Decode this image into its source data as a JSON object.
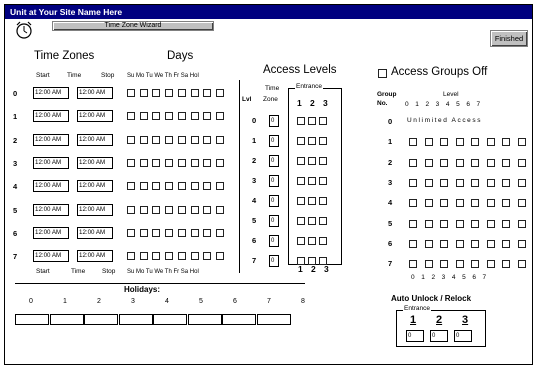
{
  "window": {
    "title": "Unit at Your Site Name Here"
  },
  "toolbar": {
    "wizard_label": "Time Zone Wizard",
    "finished_label": "Finished"
  },
  "timezones": {
    "title": "Time Zones",
    "days_title": "Days",
    "head_start": "Start",
    "head_time": "Time",
    "head_stop": "Stop",
    "days_header": "Su Mo Tu We Th Fr Sa Hol",
    "rows": [
      {
        "num": "0",
        "start": "12:00 AM",
        "stop": "12:00 AM"
      },
      {
        "num": "1",
        "start": "12:00 AM",
        "stop": "12:00 AM"
      },
      {
        "num": "2",
        "start": "12:00 AM",
        "stop": "12:00 AM"
      },
      {
        "num": "3",
        "start": "12:00 AM",
        "stop": "12:00 AM"
      },
      {
        "num": "4",
        "start": "12:00 AM",
        "stop": "12:00 AM"
      },
      {
        "num": "5",
        "start": "12:00 AM",
        "stop": "12:00 AM"
      },
      {
        "num": "6",
        "start": "12:00 AM",
        "stop": "12:00 AM"
      },
      {
        "num": "7",
        "start": "12:00 AM",
        "stop": "12:00 AM"
      }
    ]
  },
  "holidays": {
    "title": "Holidays:",
    "labels": [
      "0",
      "1",
      "2",
      "3",
      "4",
      "5",
      "6",
      "7",
      "8"
    ]
  },
  "access_levels": {
    "title": "Access Levels",
    "lvl_label": "Lvl",
    "tz_label1": "Time",
    "tz_label2": "Zone",
    "entrance_label": "Entrance",
    "entrance_nums": [
      "1",
      "2",
      "3"
    ],
    "rows": [
      {
        "num": "0",
        "zone": "0"
      },
      {
        "num": "1",
        "zone": "0"
      },
      {
        "num": "2",
        "zone": "0"
      },
      {
        "num": "3",
        "zone": "0"
      },
      {
        "num": "4",
        "zone": "0"
      },
      {
        "num": "5",
        "zone": "0"
      },
      {
        "num": "6",
        "zone": "0"
      },
      {
        "num": "7",
        "zone": "0"
      }
    ]
  },
  "access_groups": {
    "title": "Access Groups Off",
    "group_label": "Group",
    "no_label": "No.",
    "level_label": "Level",
    "level_nums": "0 1 2 3 4 5 6 7",
    "unlimited": "Unlimited Access",
    "row_nums": [
      "0",
      "1",
      "2",
      "3",
      "4",
      "5",
      "6",
      "7"
    ]
  },
  "auto_unlock": {
    "title": "Auto Unlock / Relock",
    "entrance_label": "Entrance",
    "entrance_nums": [
      "1",
      "2",
      "3"
    ],
    "values": [
      "0",
      "0",
      "0"
    ]
  }
}
